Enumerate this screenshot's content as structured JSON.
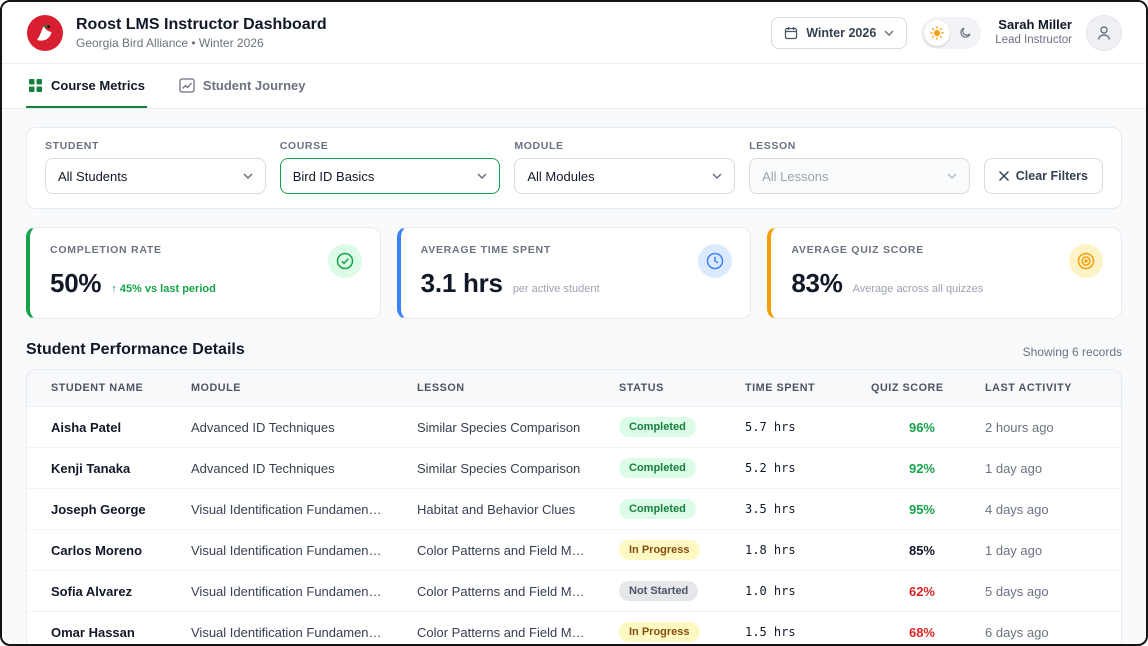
{
  "colors": {
    "green": "#16a34a",
    "blue": "#3b82f6",
    "amber": "#f59e0b",
    "red": "#dc2626"
  },
  "header": {
    "title": "Roost LMS Instructor Dashboard",
    "subtitle": "Georgia Bird Alliance • Winter 2026",
    "term": "Winter 2026",
    "user": {
      "name": "Sarah Miller",
      "role": "Lead Instructor"
    }
  },
  "tabs": [
    {
      "label": "Course Metrics"
    },
    {
      "label": "Student Journey"
    }
  ],
  "filters": {
    "student": {
      "label": "STUDENT",
      "value": "All Students"
    },
    "course": {
      "label": "COURSE",
      "value": "Bird ID Basics"
    },
    "module": {
      "label": "MODULE",
      "value": "All Modules"
    },
    "lesson": {
      "label": "LESSON",
      "value": "All Lessons"
    },
    "clear_label": "Clear Filters"
  },
  "metrics": [
    {
      "label": "COMPLETION RATE",
      "value": "50%",
      "sub": "↑ 45% vs last period",
      "tone": "green",
      "icon": "check-circle"
    },
    {
      "label": "AVERAGE TIME SPENT",
      "value": "3.1 hrs",
      "sub": "per active student",
      "tone": "blue",
      "icon": "clock"
    },
    {
      "label": "AVERAGE QUIZ SCORE",
      "value": "83%",
      "sub": "Average across all quizzes",
      "tone": "amber",
      "icon": "target"
    }
  ],
  "table": {
    "title": "Student Performance Details",
    "records_text": "Showing 6 records",
    "columns": [
      "STUDENT NAME",
      "MODULE",
      "LESSON",
      "STATUS",
      "TIME SPENT",
      "QUIZ SCORE",
      "LAST ACTIVITY"
    ],
    "rows": [
      {
        "name": "Aisha Patel",
        "module": "Advanced ID Techniques",
        "lesson": "Similar Species Comparison",
        "status": "Completed",
        "status_tone": "completed",
        "time": "5.7 hrs",
        "score": "96%",
        "score_tone": "good",
        "activity": "2 hours ago"
      },
      {
        "name": "Kenji Tanaka",
        "module": "Advanced ID Techniques",
        "lesson": "Similar Species Comparison",
        "status": "Completed",
        "status_tone": "completed",
        "time": "5.2 hrs",
        "score": "92%",
        "score_tone": "good",
        "activity": "1 day ago"
      },
      {
        "name": "Joseph George",
        "module": "Visual Identification Fundamentals",
        "lesson": "Habitat and Behavior Clues",
        "status": "Completed",
        "status_tone": "completed",
        "time": "3.5 hrs",
        "score": "95%",
        "score_tone": "good",
        "activity": "4 days ago"
      },
      {
        "name": "Carlos Moreno",
        "module": "Visual Identification Fundamentals",
        "lesson": "Color Patterns and Field Marks",
        "status": "In Progress",
        "status_tone": "in-progress",
        "time": "1.8 hrs",
        "score": "85%",
        "score_tone": "neutral",
        "activity": "1 day ago"
      },
      {
        "name": "Sofia Alvarez",
        "module": "Visual Identification Fundamentals",
        "lesson": "Color Patterns and Field Marks",
        "status": "Not Started",
        "status_tone": "not-started",
        "time": "1.0 hrs",
        "score": "62%",
        "score_tone": "bad",
        "activity": "5 days ago"
      },
      {
        "name": "Omar Hassan",
        "module": "Visual Identification Fundamentals",
        "lesson": "Color Patterns and Field Marks",
        "status": "In Progress",
        "status_tone": "in-progress",
        "time": "1.5 hrs",
        "score": "68%",
        "score_tone": "bad",
        "activity": "6 days ago"
      }
    ]
  }
}
